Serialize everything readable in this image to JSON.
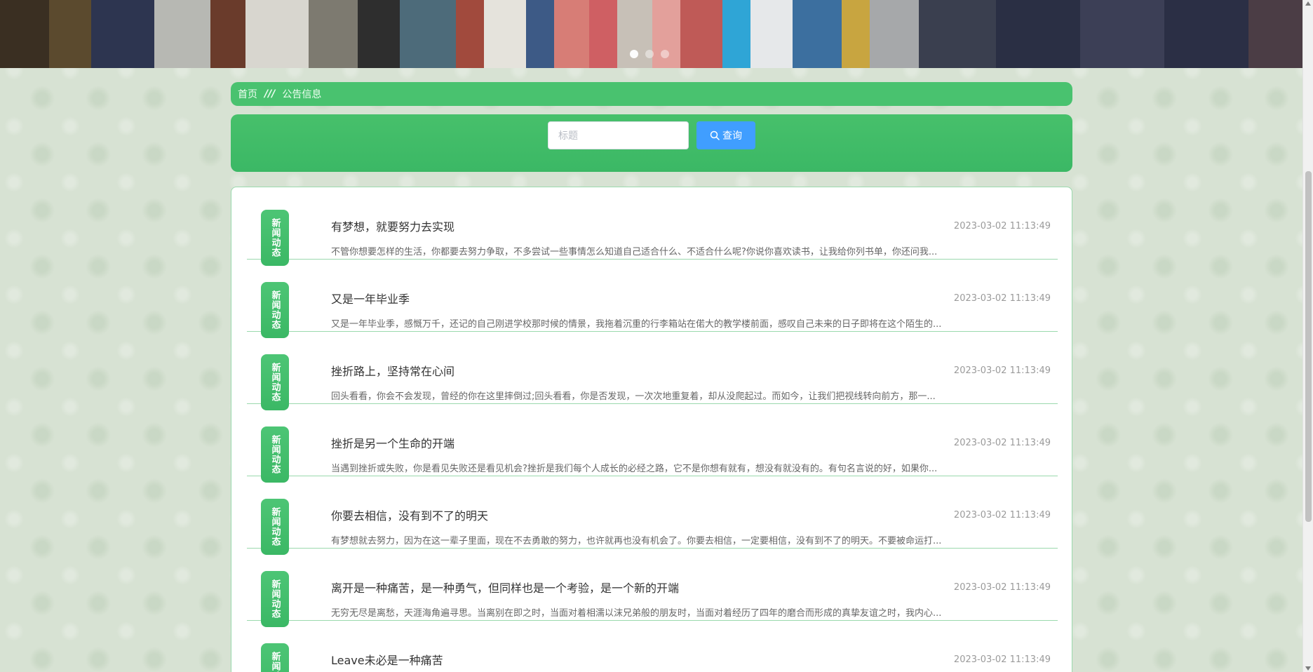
{
  "breadcrumb": {
    "home": "首页",
    "separator": "///",
    "current": "公告信息"
  },
  "search": {
    "placeholder": "标题",
    "button_label": "查询"
  },
  "carousel": {
    "slides": 3,
    "active_index": 0
  },
  "notices": [
    {
      "tag": "新闻动态",
      "title": "有梦想，就要努力去实现",
      "date": "2023-03-02 11:13:49",
      "summary": "不管你想要怎样的生活，你都要去努力争取，不多尝试一些事情怎么知道自己适合什么、不适合什么呢?你说你喜欢读书，让我给你列书单，你还问我..."
    },
    {
      "tag": "新闻动态",
      "title": "又是一年毕业季",
      "date": "2023-03-02 11:13:49",
      "summary": "又是一年毕业季，感慨万千，还记的自己刚进学校那时候的情景，我拖着沉重的行李箱站在偌大的教学楼前面，感叹自己未来的日子即将在这个陌生的..."
    },
    {
      "tag": "新闻动态",
      "title": "挫折路上，坚持常在心间",
      "date": "2023-03-02 11:13:49",
      "summary": "回头看看，你会不会发现，曾经的你在这里摔倒过;回头看看，你是否发现，一次次地重复着，却从没爬起过。而如今，让我们把视线转向前方，那一..."
    },
    {
      "tag": "新闻动态",
      "title": "挫折是另一个生命的开端",
      "date": "2023-03-02 11:13:49",
      "summary": "当遇到挫折或失败，你是看见失败还是看见机会?挫折是我们每个人成长的必经之路，它不是你想有就有，想没有就没有的。有句名言说的好，如果你..."
    },
    {
      "tag": "新闻动态",
      "title": "你要去相信，没有到不了的明天",
      "date": "2023-03-02 11:13:49",
      "summary": "有梦想就去努力，因为在这一辈子里面，现在不去勇敢的努力，也许就再也没有机会了。你要去相信，一定要相信，没有到不了的明天。不要被命运打..."
    },
    {
      "tag": "新闻动态",
      "title": "离开是一种痛苦，是一种勇气，但同样也是一个考验，是一个新的开端",
      "date": "2023-03-02 11:13:49",
      "summary": "无穷无尽是离愁，天涯海角遍寻思。当离别在即之时，当面对着相濡以沫兄弟般的朋友时，当面对着经历了四年的磨合而形成的真挚友谊之时，我内心..."
    },
    {
      "tag": "新闻动态",
      "title": "Leave未必是一种痛苦",
      "date": "2023-03-02 11:13:49",
      "summary": ""
    }
  ]
}
